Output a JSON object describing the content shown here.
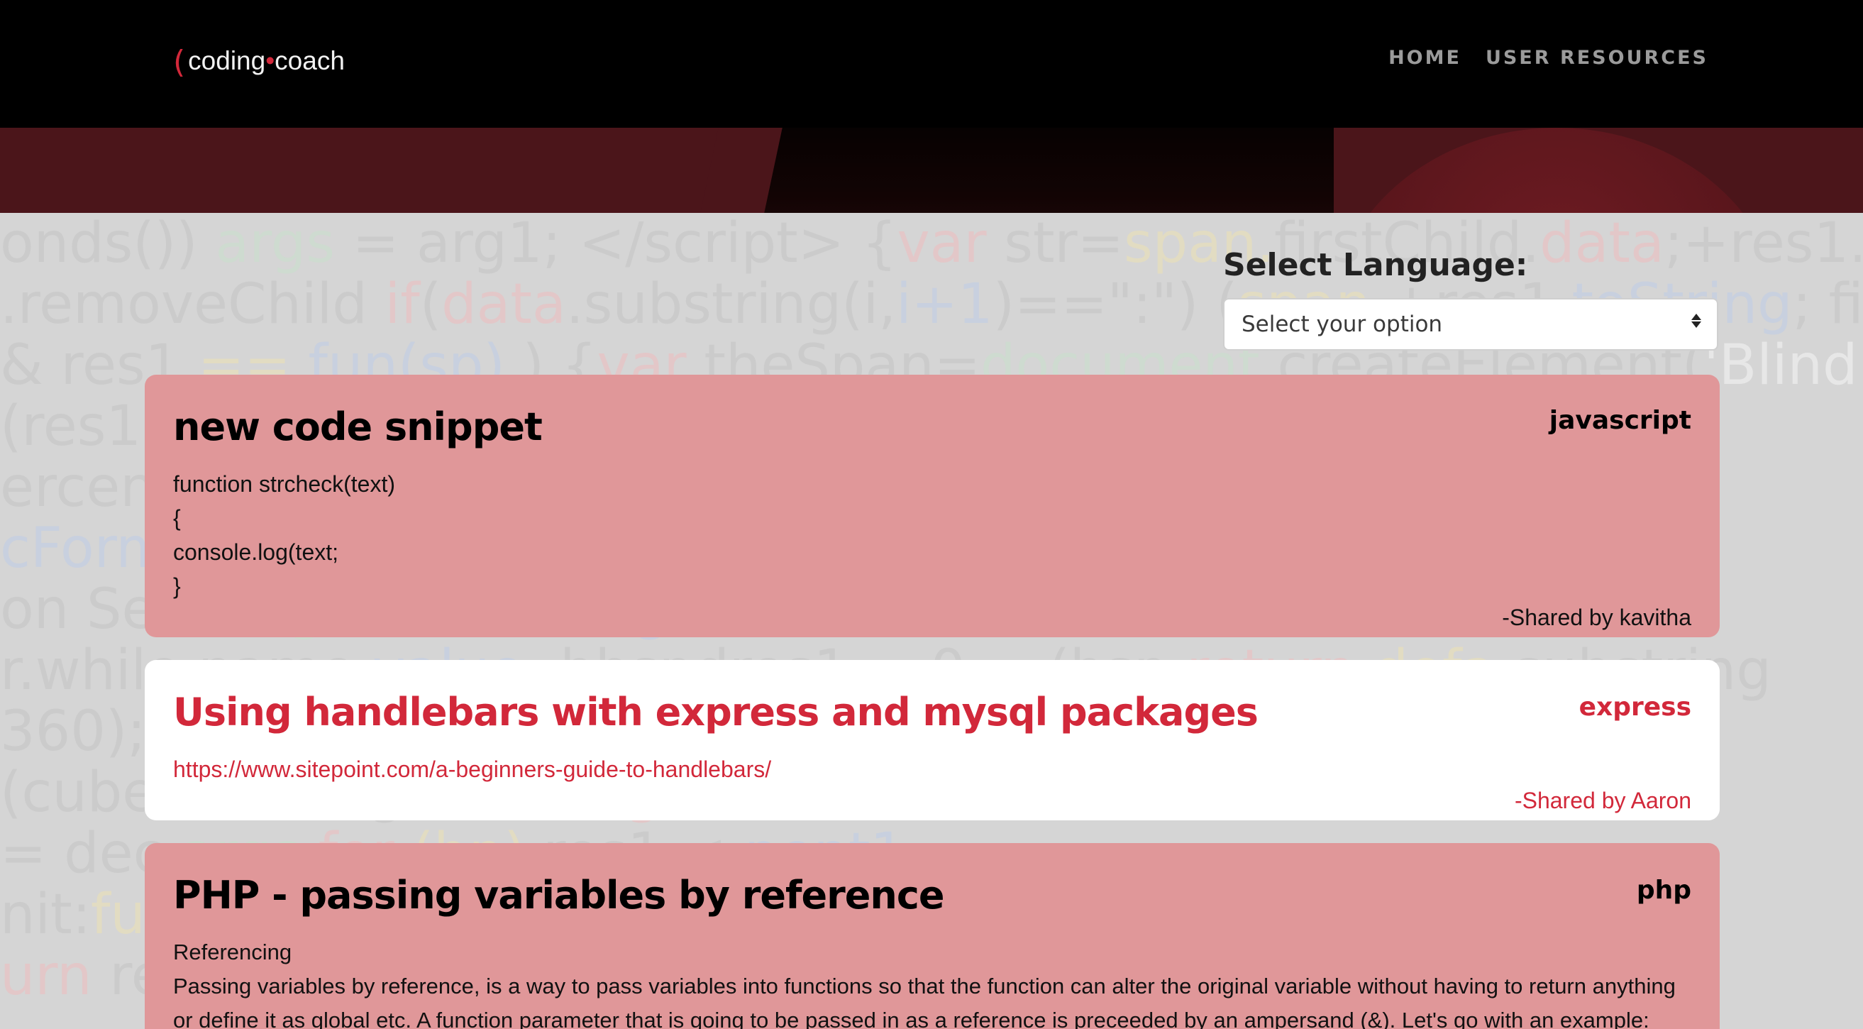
{
  "header": {
    "logo_paren": "( )",
    "logo_word1": "coding",
    "logo_dot": "•",
    "logo_word2": "coach",
    "nav": [
      {
        "label": "HOME"
      },
      {
        "label": "USER RESOURCES"
      }
    ]
  },
  "filter": {
    "label": "Select Language:",
    "selected": "Select your option"
  },
  "cards": [
    {
      "title": "new code snippet",
      "language": "javascript",
      "body_lines": [
        "function strcheck(text)",
        "{",
        "console.log(text;",
        "}"
      ],
      "author": "-Shared by kavitha"
    },
    {
      "title": "Using handlebars with express and mysql packages",
      "language": "express",
      "link": "https://www.sitepoint.com/a-beginners-guide-to-handlebars/",
      "author": "-Shared by Aaron"
    },
    {
      "title": "PHP - passing variables by reference",
      "language": "php",
      "body_lines": [
        "Referencing",
        "Passing variables by reference, is a way to pass variables into functions so that the function can alter the original variable without having to return anything",
        "or define it as global etc. A function parameter that is going to be passed in as a reference is preceeded by an ampersand (&). Let's go with an example:"
      ]
    }
  ],
  "colors": {
    "accent": "#d2283a",
    "card_pink": "#e09799",
    "card_white": "#ffffff",
    "header_bg": "#000000",
    "banner": "#4b151a"
  }
}
